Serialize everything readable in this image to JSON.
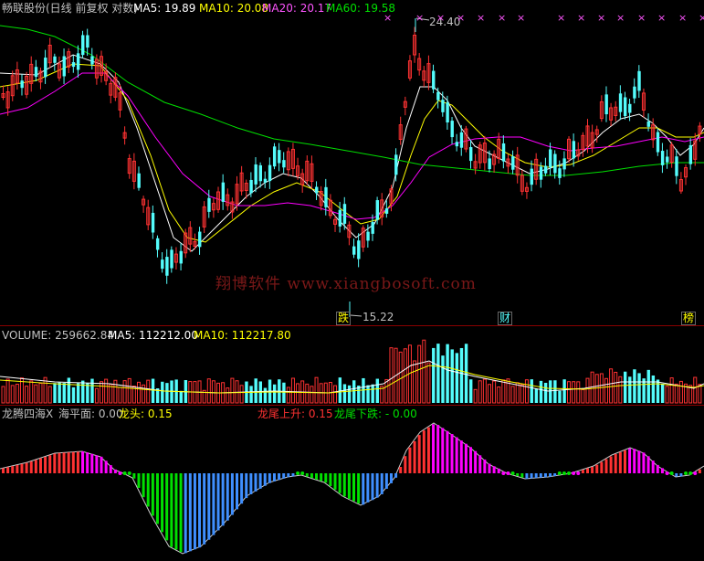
{
  "price_panel": {
    "title": "畅联股份(日线 前复权 对数)",
    "ma5_label": "MA5: 19.89",
    "ma10_label": "MA10: 20.08",
    "ma20_label": "MA20: 20.17",
    "ma60_label": "MA60: 19.58",
    "high_marker": "24.40",
    "low_marker": "15.22",
    "tag_fall": "跌",
    "tag_finance": "财",
    "tag_list": "榜",
    "watermark": "翔博软件 www.xiangbosoft.com"
  },
  "volume_panel": {
    "volume_label": "VOLUME: 259662.84",
    "ma5_label": "MA5: 112212.00",
    "ma10_label": "MA10: 112217.80"
  },
  "indicator_panel": {
    "name": "龙腾四海X",
    "sea_label": "海平面: 0.00",
    "dragon_head": "龙头: 0.15",
    "tail_up": "龙尾上升: 0.15",
    "tail_down": "龙尾下跌: - 0.00"
  },
  "colors": {
    "up": "#ff3232",
    "down": "#54fcfc",
    "ma5": "#ffffff",
    "ma10": "#ffff00",
    "ma20": "#ff00ff",
    "ma60": "#00e000",
    "ind_red": "#ff3232",
    "ind_magenta": "#ff00ff",
    "ind_green": "#00e000",
    "ind_blue": "#3f8fff"
  }
}
